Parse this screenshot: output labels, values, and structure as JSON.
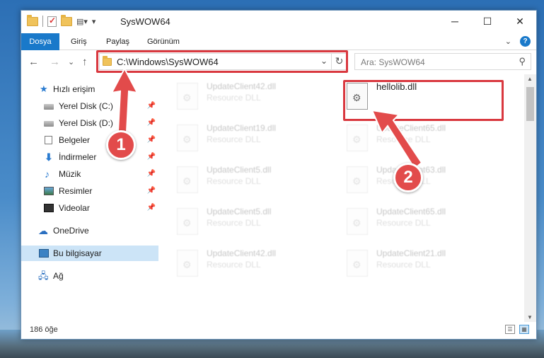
{
  "window": {
    "title": "SysWOW64",
    "minimize": "─",
    "maximize": "☐",
    "close": "✕"
  },
  "ribbon": {
    "tabs": [
      "Dosya",
      "Giriş",
      "Paylaş",
      "Görünüm"
    ],
    "expand": "⌄",
    "help": "?"
  },
  "nav": {
    "back": "←",
    "forward": "→",
    "recent": "⌄",
    "up": "↑",
    "address": "C:\\Windows\\SysWOW64",
    "address_dropdown": "⌄",
    "refresh": "↻",
    "search_placeholder": "Ara: SysWOW64",
    "search_icon": "⚲"
  },
  "sidebar": {
    "items": [
      {
        "label": "Hızlı erişim",
        "icon": "star-icon"
      },
      {
        "label": "Yerel Disk (C:)",
        "icon": "disk-icon",
        "pinned": true
      },
      {
        "label": "Yerel Disk (D:)",
        "icon": "disk-icon",
        "pinned": true
      },
      {
        "label": "Belgeler",
        "icon": "documents-icon",
        "pinned": true
      },
      {
        "label": "İndirmeler",
        "icon": "download-icon",
        "pinned": true
      },
      {
        "label": "Müzik",
        "icon": "music-icon",
        "pinned": true
      },
      {
        "label": "Resimler",
        "icon": "pictures-icon",
        "pinned": true
      },
      {
        "label": "Videolar",
        "icon": "videos-icon",
        "pinned": true
      },
      {
        "label": "OneDrive",
        "icon": "cloud-icon"
      },
      {
        "label": "Bu bilgisayar",
        "icon": "computer-icon",
        "selected": true
      },
      {
        "label": "Ağ",
        "icon": "network-icon"
      }
    ],
    "pin_glyph": "📌"
  },
  "files": {
    "left_column": [
      {
        "name": "UpdateClient42.dll",
        "desc": "Resource DLL"
      },
      {
        "name": "UpdateClient19.dll",
        "desc": "Resource DLL"
      },
      {
        "name": "UpdateClient5.dll",
        "desc": "Resource DLL"
      },
      {
        "name": "UpdateClient5.dll",
        "desc": "Resource DLL"
      },
      {
        "name": "UpdateClient42.dll",
        "desc": "Resource DLL"
      }
    ],
    "right_column": [
      {
        "name": "hellolib.dll",
        "desc": ""
      },
      {
        "name": "UpdateClient65.dll",
        "desc": "Resource DLL"
      },
      {
        "name": "UpdateClient63.dll",
        "desc": "Resource DLL"
      },
      {
        "name": "UpdateClient65.dll",
        "desc": "Resource DLL"
      },
      {
        "name": "UpdateClient21.dll",
        "desc": "Resource DLL"
      }
    ]
  },
  "status": {
    "count": "186 öğe"
  },
  "annotations": {
    "badge1": "1",
    "badge2": "2",
    "color": "#e24b4b"
  }
}
